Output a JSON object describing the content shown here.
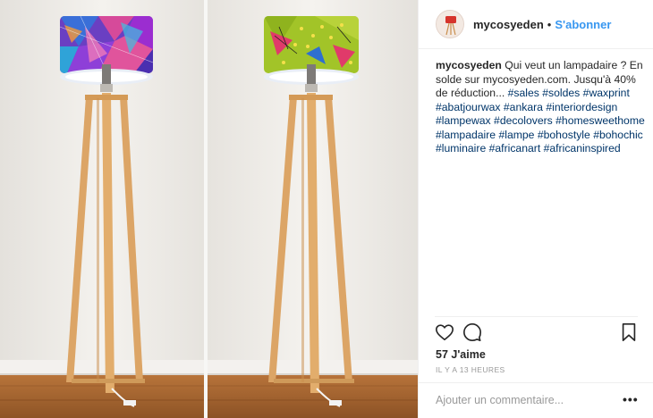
{
  "post": {
    "username": "mycosyeden",
    "separator": "•",
    "follow_label": "S'abonner",
    "caption_text": "Qui veut un lampadaire ? En solde sur mycosyeden.com. Jusqu'à 40% de réduction...",
    "hashtags": [
      "#sales",
      "#soldes",
      "#waxprint",
      "#abatjourwax",
      "#ankara",
      "#interiordesign",
      "#lampewax",
      "#decolovers",
      "#homesweethome",
      "#lampadaire",
      "#lampe",
      "#bohostyle",
      "#bohochic",
      "#luminaire",
      "#africanart",
      "#africaninspired"
    ],
    "likes": "57 J'aime",
    "timestamp": "IL Y A 13 HEURES",
    "comment_placeholder": "Ajouter un commentaire...",
    "more_label": "•••"
  },
  "icons": {
    "like": "heart-icon",
    "comment": "comment-icon",
    "save": "bookmark-icon",
    "more": "more-options-icon"
  },
  "colors": {
    "link_blue": "#3897f0",
    "hashtag": "#003569",
    "text": "#262626",
    "muted": "#999999",
    "wood": "#d9a05c",
    "shade_left": "#7a4bd1",
    "shade_right": "#a6c52a"
  }
}
